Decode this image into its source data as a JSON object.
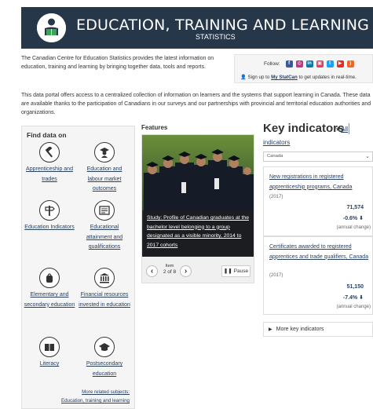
{
  "banner": {
    "title": "EDUCATION, TRAINING AND LEARNING",
    "subtitle": "STATISTICS"
  },
  "intro": {
    "text": "The Canadian Centre for Education Statistics provides the latest information on education, training and learning by bringing together data, tools and reports."
  },
  "follow": {
    "label": "Follow:",
    "signup_prefix": "Sign up to",
    "signup_link": "My StatCan",
    "signup_suffix": "to get updates in real-time."
  },
  "portal": {
    "text": "This data portal offers access to a centralized collection of information on learners and the systems that support learning in Canada. These data are available thanks to the participation of Canadians in our surveys and our partnerships with provincial and territorial education authorities and organizations."
  },
  "find_data": {
    "heading": "Find data on",
    "items": [
      {
        "label": "Apprenticeship and trades",
        "icon": "hammer-icon"
      },
      {
        "label": "Education and labour market outcomes",
        "icon": "graduate-icon"
      },
      {
        "label": "Education Indicators",
        "icon": "signpost-icon"
      },
      {
        "label": "Educational attainment and qualifications",
        "icon": "diploma-icon"
      },
      {
        "label": "Elementary and secondary education",
        "icon": "backpack-icon"
      },
      {
        "label": "Financial resources invested in education",
        "icon": "bank-icon"
      },
      {
        "label": "Literacy",
        "icon": "book-icon"
      },
      {
        "label": "Postsecondary education",
        "icon": "mortarboard-icon"
      }
    ],
    "more_line1": "More related subjects:",
    "more_line2": "Education, training and learning"
  },
  "features": {
    "heading": "Features",
    "caption": "Study: Profile of Canadian graduates at the bachelor level belonging to a group designated as a visible minority, 2014 to 2017 cohorts",
    "item_label": "Item",
    "item_count": "2 of 8",
    "pause_label": "Pause"
  },
  "key_indicators": {
    "title": "Key indicators",
    "all_label": "All",
    "all_label2": "indicators",
    "geo": "Canada",
    "cards": [
      {
        "title": "New registrations in registered apprenticeship programs, Canada",
        "year": "(2017)",
        "value": "71,574",
        "change": "-0.6%",
        "change_label": "(annual change)"
      },
      {
        "title": "Certificates awarded to registered apprentices and trade qualifiers, Canada",
        "year": "(2017)",
        "value": "51,150",
        "change": "-7.4%",
        "change_label": "(annual change)"
      }
    ],
    "more_label": "More key indicators"
  },
  "colors": {
    "banner": "#26374a",
    "link": "#284162",
    "facebook": "#3b5998",
    "instagram": "#c13584",
    "linkedin": "#0e76a8",
    "youtube": "#e52d27",
    "twitter": "#1da1f2",
    "rss": "#f26522"
  }
}
